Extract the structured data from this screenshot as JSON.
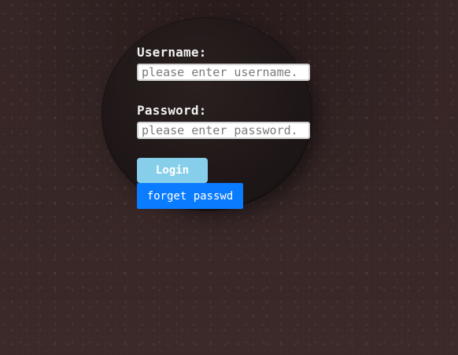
{
  "form": {
    "username_label": "Username:",
    "username_placeholder": "please enter username.",
    "username_value": "",
    "password_label": "Password:",
    "password_placeholder": "please enter password.",
    "password_value": ""
  },
  "actions": {
    "login_label": "Login",
    "forget_label": "forget passwd"
  },
  "colors": {
    "login_button": "#87ceeb",
    "forget_button": "#0a7cff",
    "text": "#f2f2f2"
  }
}
